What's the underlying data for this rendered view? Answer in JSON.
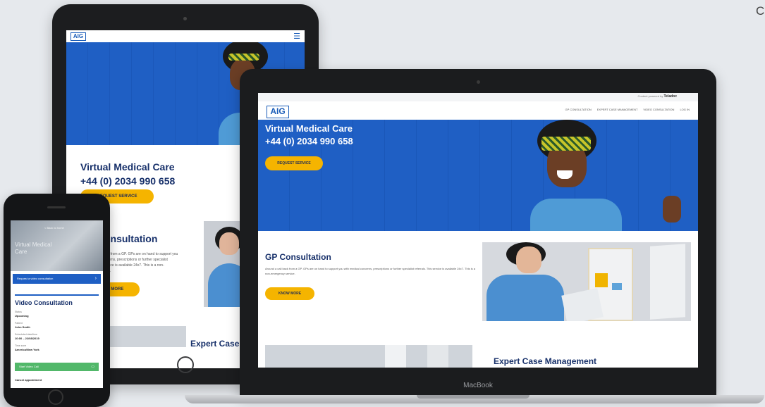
{
  "corner_text": "C",
  "brand": {
    "logo": "AIG",
    "accent": "#1f5fc4",
    "cta": "#f5b400",
    "heading": "#17306a"
  },
  "tablet": {
    "menu_icon": "hamburger-icon",
    "hero_title_line1": "Virtual Medical Care",
    "hero_title_line2": "+44 (0) 2034 990 658",
    "request_button": "REQUEST SERVICE",
    "consultation_title": "GP Consultation",
    "consultation_text": "Around a call back from a GP. GPs are on hand to support you with medical concerns, prescriptions or further specialist referrals. This service is available 24x7. This is a non-emergency service.",
    "know_more_button": "KNOW MORE",
    "expert_title": "Expert Case Management"
  },
  "laptop": {
    "brand_label": "MacBook",
    "powered_by": "Content powered by",
    "powered_brand": "Teladoc",
    "nav_items": [
      "GP CONSULTATION",
      "EXPERT CASE MANAGEMENT",
      "VIDEO CONSULTATION",
      "LOG IN"
    ],
    "hero_title_line1": "Virtual Medical Care",
    "hero_title_line2": "+44 (0) 2034 990 658",
    "request_button": "REQUEST SERVICE",
    "consultation_title": "GP Consultation",
    "consultation_text": "Around a call back from a GP. GPs are on hand to support you with medical concerns, prescriptions or further specialist referrals. This service is available 24x7. This is a non-emergency service.",
    "know_more_button": "KNOW MORE",
    "expert_title": "Expert Case Management"
  },
  "phone": {
    "back_link": "< Back to home",
    "hero_title": "Virtual Medical Care",
    "request_bar": "Request a video consultation",
    "video_title": "Video Consultation",
    "fields": [
      {
        "label": "Status",
        "value": "Upcoming"
      },
      {
        "label": "Patient",
        "value": "John Smith"
      },
      {
        "label": "Scheduled date/time",
        "value": "10:00 – 22/08/2019"
      },
      {
        "label": "Time zone",
        "value": "America/New York"
      }
    ],
    "start_video": "Start Video Call",
    "cancel": "Cancel appointment"
  }
}
